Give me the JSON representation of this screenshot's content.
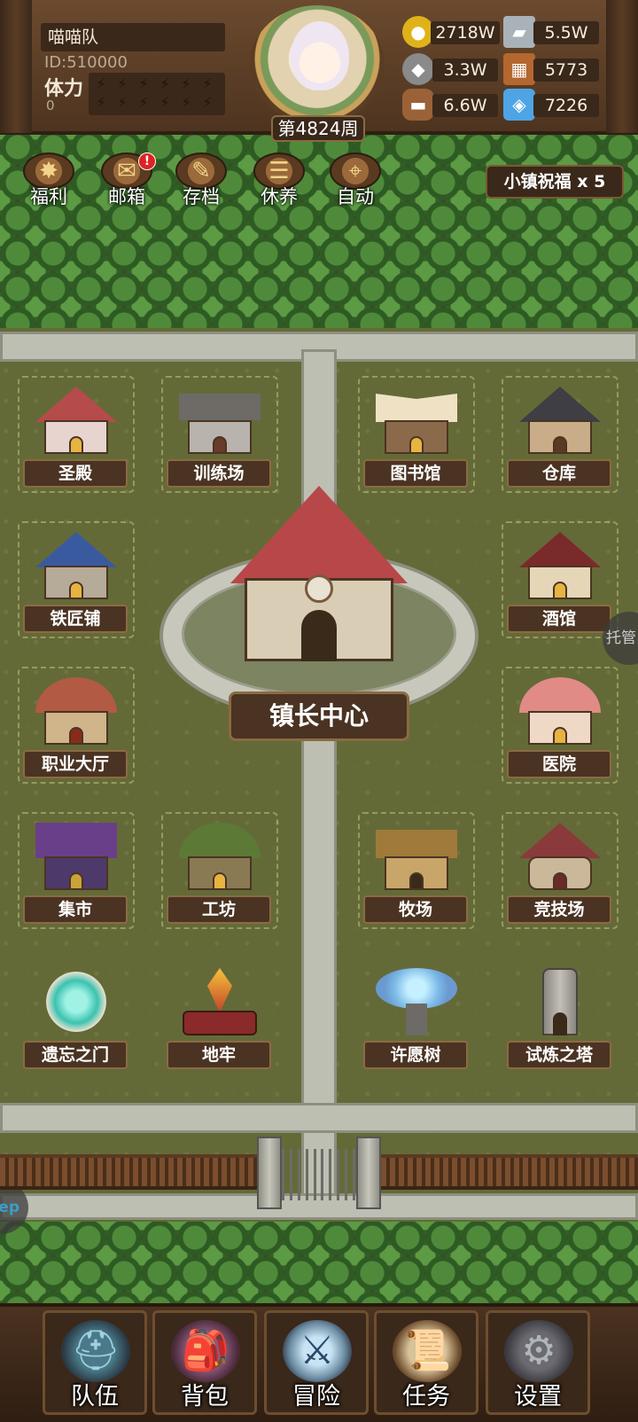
{
  "player": {
    "team_name": "喵喵队",
    "id": "ID:510000",
    "stamina_label": "体力",
    "stamina_value": "0",
    "week": "第4824周"
  },
  "resources": [
    {
      "name": "gold",
      "icon": "gold-coin-icon",
      "value": "2718W",
      "color": "#e0b21a"
    },
    {
      "name": "iron",
      "icon": "iron-ingot-icon",
      "value": "5.5W",
      "color": "#a9b2b8"
    },
    {
      "name": "stone",
      "icon": "stone-icon",
      "value": "3.3W",
      "color": "#8a8a8a"
    },
    {
      "name": "leather",
      "icon": "leather-icon",
      "value": "5773",
      "color": "#b4672f"
    },
    {
      "name": "wood",
      "icon": "wood-log-icon",
      "value": "6.6W",
      "color": "#9a6236"
    },
    {
      "name": "crystal",
      "icon": "crystal-icon",
      "value": "7226",
      "color": "#4fa4e6"
    }
  ],
  "top_menu": [
    {
      "label": "福利",
      "icon": "welfare-wheel-icon"
    },
    {
      "label": "邮箱",
      "icon": "mailbox-icon",
      "badge": "!"
    },
    {
      "label": "存档",
      "icon": "save-scroll-icon"
    },
    {
      "label": "休养",
      "icon": "rest-scroll-icon"
    },
    {
      "label": "自动",
      "icon": "auto-map-icon"
    }
  ],
  "blessing": "小镇祝福 x 5",
  "buildings": {
    "temple": "圣殿",
    "training": "训练场",
    "library": "图书馆",
    "warehouse": "仓库",
    "smithy": "铁匠铺",
    "tavern": "酒馆",
    "job_hall": "职业大厅",
    "hospital": "医院",
    "market": "集市",
    "workshop": "工坊",
    "ranch": "牧场",
    "arena": "竞技场",
    "forgotten_gate": "遗忘之门",
    "dungeon": "地牢",
    "wishing_tree": "许愿树",
    "trial_tower": "试炼之塔",
    "mayor_center": "镇长中心"
  },
  "side": {
    "auto_manage": "托管",
    "left_pill": "ep"
  },
  "bottom_nav": [
    {
      "label": "队伍",
      "icon": "helmet-icon"
    },
    {
      "label": "背包",
      "icon": "backpack-icon"
    },
    {
      "label": "冒险",
      "icon": "crossed-swords-icon"
    },
    {
      "label": "任务",
      "icon": "quest-scroll-icon"
    },
    {
      "label": "设置",
      "icon": "gear-icon"
    }
  ]
}
